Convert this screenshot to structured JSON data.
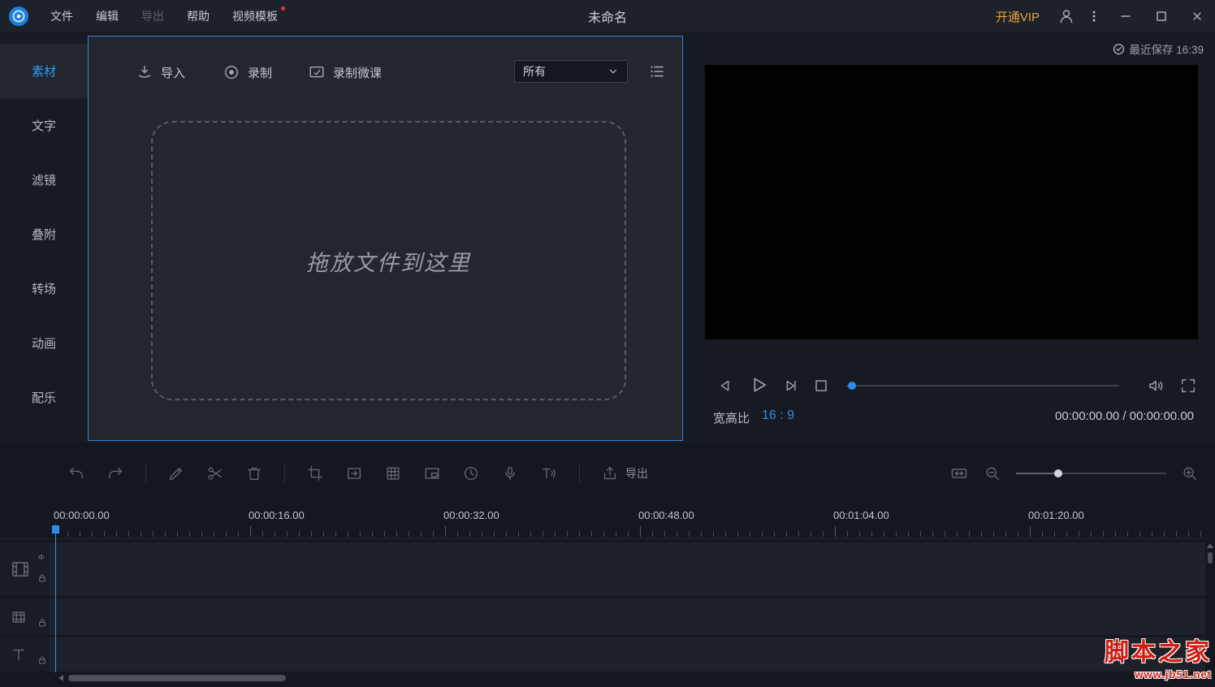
{
  "titlebar": {
    "title": "未命名",
    "menu_file": "文件",
    "menu_edit": "编辑",
    "menu_export": "导出",
    "menu_help": "帮助",
    "menu_templates": "视频模板",
    "vip_label": "开通VIP"
  },
  "sidebar": {
    "items": [
      {
        "label": "素材",
        "active": true
      },
      {
        "label": "文字",
        "active": false
      },
      {
        "label": "滤镜",
        "active": false
      },
      {
        "label": "叠附",
        "active": false
      },
      {
        "label": "转场",
        "active": false
      },
      {
        "label": "动画",
        "active": false
      },
      {
        "label": "配乐",
        "active": false
      }
    ]
  },
  "material": {
    "import_label": "导入",
    "record_label": "录制",
    "record_lesson_label": "录制微课",
    "filter_value": "所有",
    "dropzone_text": "拖放文件到这里"
  },
  "preview": {
    "last_saved": "最近保存 16:39",
    "aspect_label": "宽高比",
    "aspect_value": "16 : 9",
    "timecode": "00:00:00.00 / 00:00:00.00"
  },
  "timeline": {
    "export_label": "导出",
    "ruler_labels": [
      "00:00:00.00",
      "00:00:16.00",
      "00:00:32.00",
      "00:00:48.00",
      "00:01:04.00",
      "00:01:20.00"
    ]
  },
  "watermark": {
    "title": "脚本之家",
    "url": "www.jb51.net"
  },
  "colors": {
    "accent_blue": "#2d8cf0",
    "vip_orange": "#e9a13b",
    "panel_border_blue": "#3584d6",
    "watermark_red": "#cf1d12",
    "badge_red": "#e23b30"
  }
}
